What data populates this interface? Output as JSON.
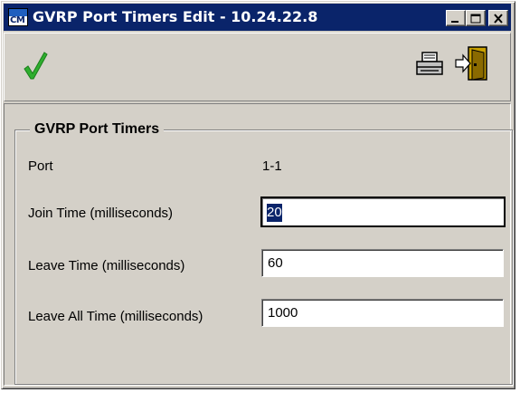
{
  "window": {
    "title": "GVRP Port Timers Edit - 10.24.22.8",
    "app_icon_text": "CM"
  },
  "toolbar": {
    "apply": "checkmark-icon",
    "print": "printer-icon",
    "exit": "exit-door-icon"
  },
  "form": {
    "group_title": "GVRP Port Timers",
    "port_label": "Port",
    "port_value": "1-1",
    "join_label": "Join Time (milliseconds)",
    "join_value": "20",
    "leave_label": "Leave Time (milliseconds)",
    "leave_value": "60",
    "leaveall_label": "Leave All Time (milliseconds)",
    "leaveall_value": "1000"
  },
  "colors": {
    "titlebar": "#0a246a",
    "face": "#d4d0c8",
    "check": "#2fae2f"
  }
}
